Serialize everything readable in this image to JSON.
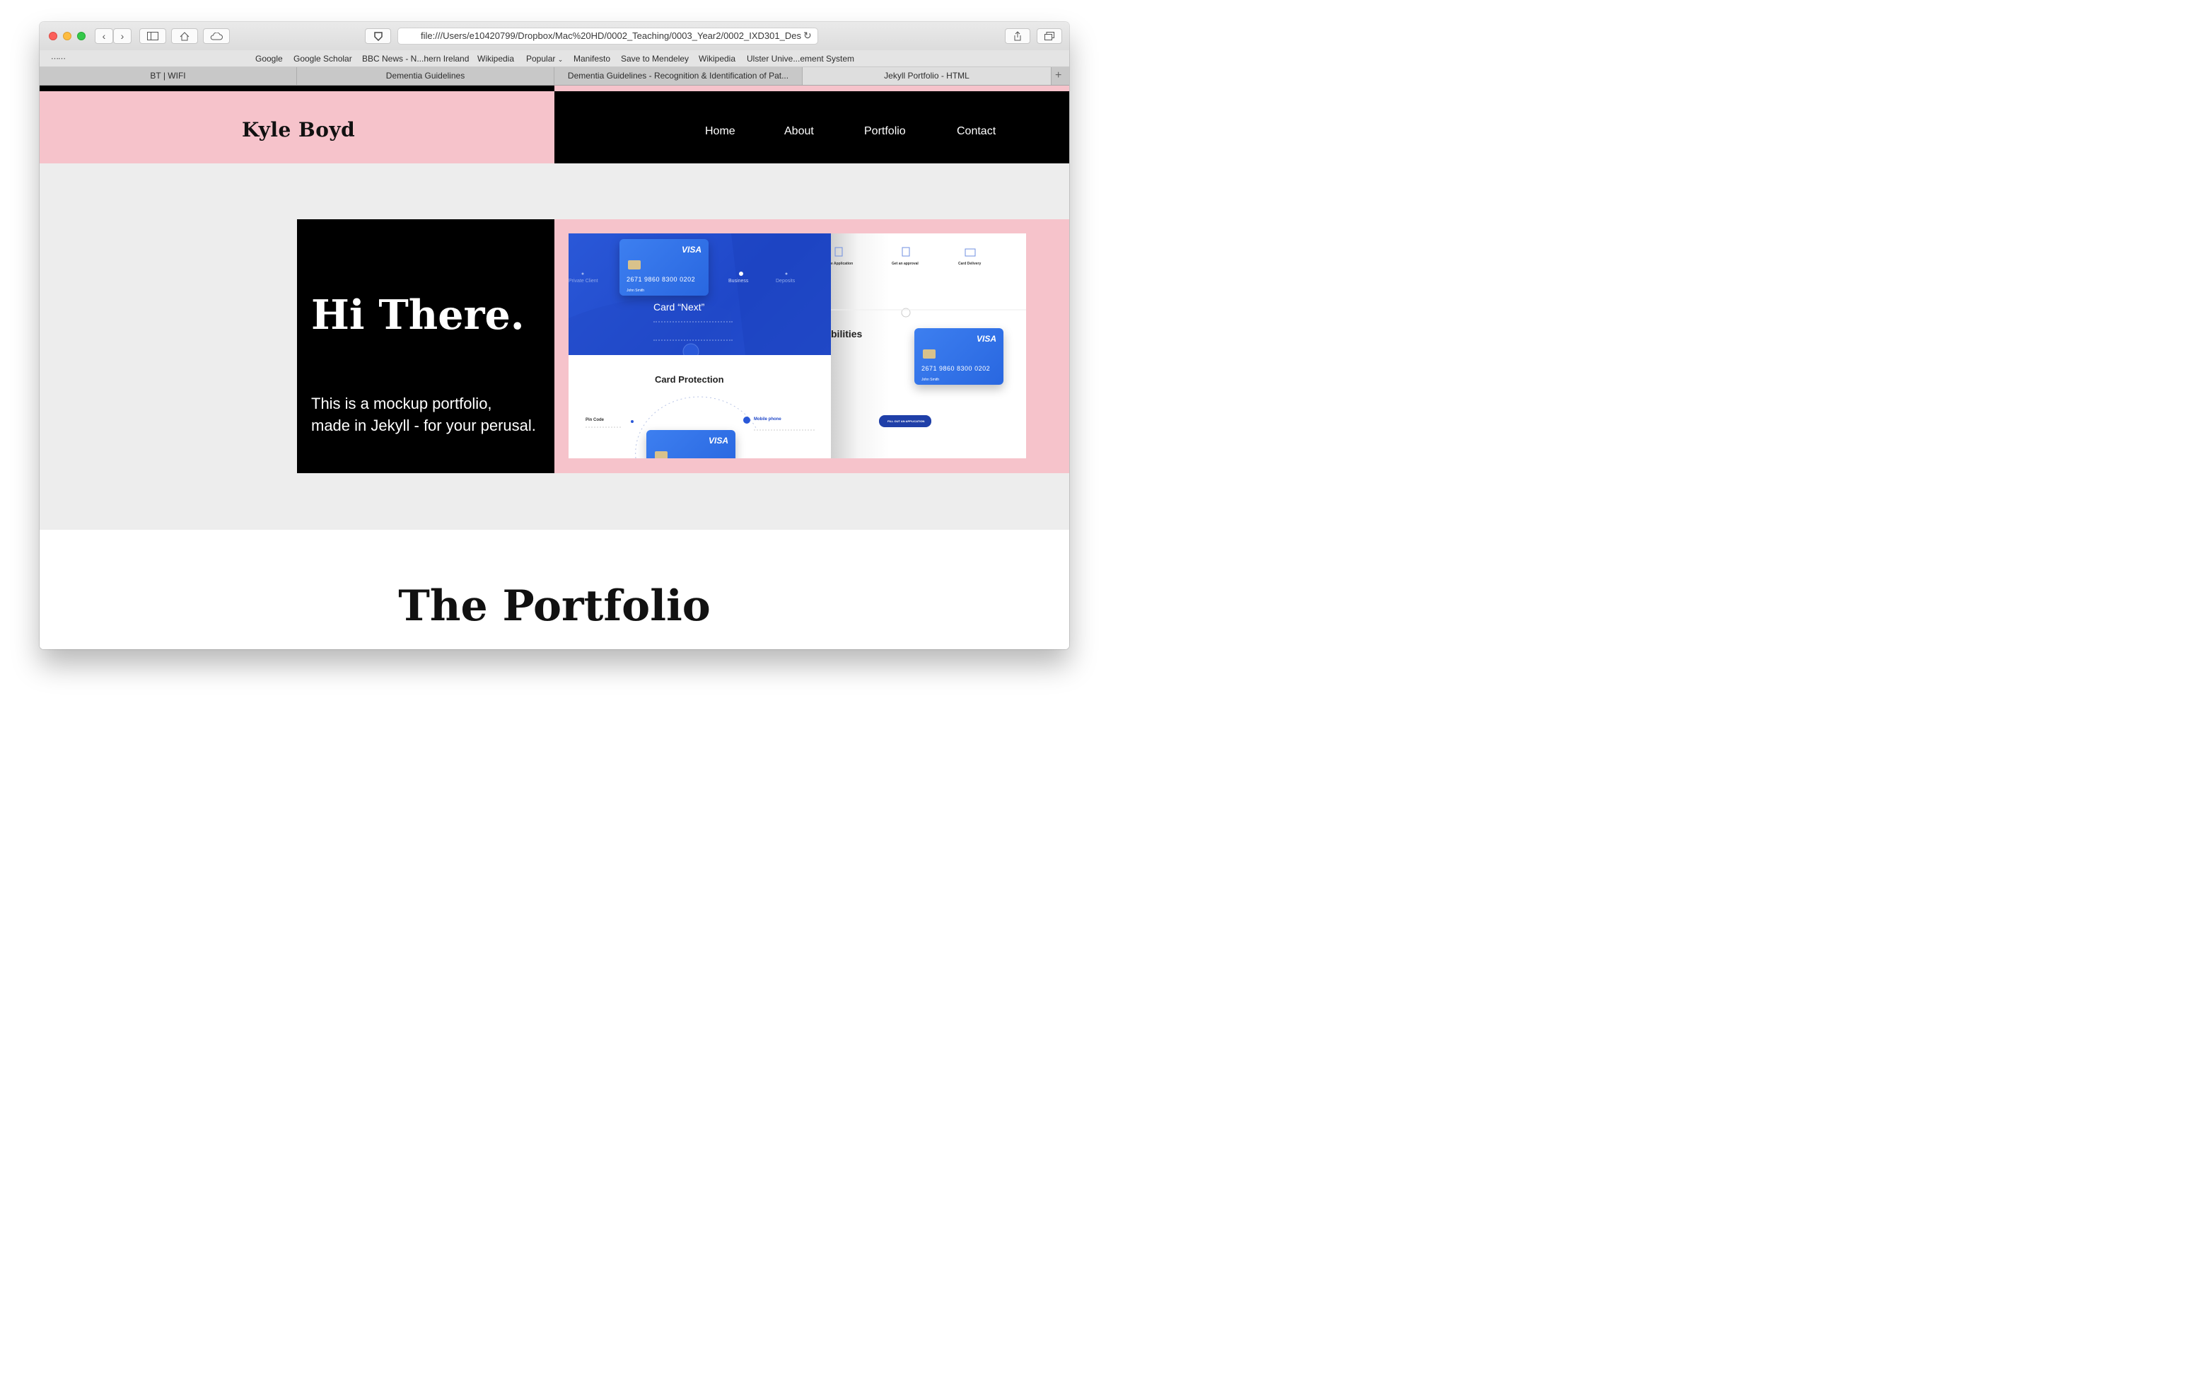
{
  "browser": {
    "url": "file:///Users/e10420799/Dropbox/Mac%20HD/0002_Teaching/0003_Year2/0002_IXD301_Des",
    "bookmarks": [
      "Google",
      "Google Scholar",
      "BBC News - N...hern Ireland",
      "Wikipedia",
      "Popular",
      "Manifesto",
      "Save to Mendeley",
      "Wikipedia",
      "Ulster Unive...ement System"
    ],
    "tabs": [
      "BT | WIFI",
      "Dementia Guidelines",
      "Dementia Guidelines - Recognition & Identification of Pat...",
      "Jekyll Portfolio - HTML"
    ],
    "active_tab": 3
  },
  "site": {
    "brand": "Kyle Boyd",
    "nav": [
      "Home",
      "About",
      "Portfolio",
      "Contact"
    ],
    "hero_title": "Hi There.",
    "hero_text_line1": "This is a mockup portfolio,",
    "hero_text_line2": "made in Jekyll - for your perusal.",
    "portfolio_title": "The Portfolio",
    "colors": {
      "pink": "#f6c3cb",
      "black": "#000000",
      "hero_bg": "#ededed",
      "card_blue": "#2a58d8"
    }
  },
  "mockup": {
    "card_next_title": "Card “Next”",
    "card_protection_title": "Card Protection",
    "card_number": "2671  9860  8300  0202",
    "card_expiry": "12—06/16",
    "card_name": "John Smith",
    "visa_label": "VISA",
    "private_client": "Private Client",
    "business": "Business",
    "deposits": "Deposits",
    "abilities": "bilities",
    "application": "e Application",
    "get_approval": "Get an approval",
    "card_delivery": "Card Delivery",
    "pin_code": "Pin Code",
    "mobile_phone": "Mobile phone",
    "fill_out_button": "FILL OUT AN APPLICATION"
  }
}
